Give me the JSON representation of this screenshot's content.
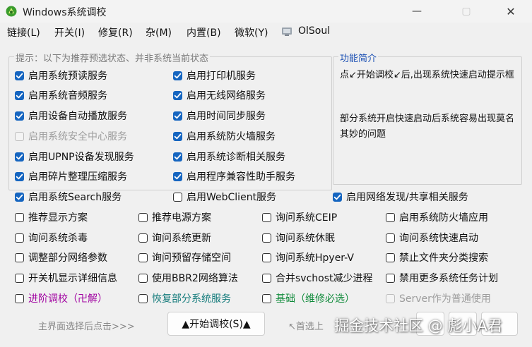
{
  "window": {
    "title": "Windows系统调校",
    "minimize": "—",
    "maximize": "▢",
    "close": "✕"
  },
  "menu": [
    "链接(L)",
    "开关(I)",
    "修复(R)",
    "杂(M)",
    "内置(B)",
    "微软(Y)",
    "OlSoul"
  ],
  "group": {
    "legend": "提示：以下为推荐预选状态、并非系统当前状态"
  },
  "info": {
    "title": "功能简介",
    "text1": "点↙开始调校↙后,出现系统快速启动提示框",
    "text2": "部分系统开启快速启动后系统容易出现莫名其妙的问题"
  },
  "checkboxes": [
    {
      "label": "启用系统预读服务",
      "checked": true
    },
    {
      "label": "启用打印机服务",
      "checked": true
    },
    {
      "label": "启用系统音频服务",
      "checked": true
    },
    {
      "label": "启用无线网络服务",
      "checked": true
    },
    {
      "label": "启用设备自动播放服务",
      "checked": true
    },
    {
      "label": "启用时间同步服务",
      "checked": true
    },
    {
      "label": "启用系统安全中心服务",
      "checked": false,
      "disabled": true
    },
    {
      "label": "启用系统防火墙服务",
      "checked": true
    },
    {
      "label": "启用UPNP设备发现服务",
      "checked": true
    },
    {
      "label": "启用系统诊断相关服务",
      "checked": true
    },
    {
      "label": "启用碎片整理压缩服务",
      "checked": true
    },
    {
      "label": "启用程序兼容性助手服务",
      "checked": true
    },
    {
      "label": "启用系统Search服务",
      "checked": true
    },
    {
      "label": "启用WebClient服务",
      "checked": false
    },
    {
      "label": "启用网络发现/共享相关服务",
      "checked": true
    },
    {
      "label": "推荐显示方案",
      "checked": false
    },
    {
      "label": "推荐电源方案",
      "checked": false
    },
    {
      "label": "询问系统CEIP",
      "checked": false
    },
    {
      "label": "启用系统防火墙应用",
      "checked": false
    },
    {
      "label": "询问系统杀毒",
      "checked": false
    },
    {
      "label": "询问系统更新",
      "checked": false
    },
    {
      "label": "询问系统休眠",
      "checked": false
    },
    {
      "label": "询问系统快速启动",
      "checked": false
    },
    {
      "label": "调整部分网络参数",
      "checked": false
    },
    {
      "label": "询问预留存储空间",
      "checked": false
    },
    {
      "label": "询问系统Hpyer-V",
      "checked": false
    },
    {
      "label": "禁止文件夹分类搜索",
      "checked": false
    },
    {
      "label": "开关机显示详细信息",
      "checked": false
    },
    {
      "label": "使用BBR2网络算法",
      "checked": false
    },
    {
      "label": "合并svchost减少进程",
      "checked": false
    },
    {
      "label": "禁用更多系统任务计划",
      "checked": false
    },
    {
      "label": "进阶调校（卍解）",
      "checked": false,
      "color": "#a000a0"
    },
    {
      "label": "恢复部分系统服务",
      "checked": false,
      "color": "#127a7a"
    },
    {
      "label": "基础（维修必选）",
      "checked": false,
      "color": "#0f8a3a"
    },
    {
      "label": "Server作为普通使用",
      "checked": false,
      "disabled": true
    }
  ],
  "footer": {
    "hint": "主界面选择后点击>>>",
    "start_button": "▲开始调校(S)▲",
    "after_hint": "↖首选上"
  },
  "watermark": "掘金技术社区 @ 彪小A君",
  "colors": {
    "checkbox_checked": "#1565c0",
    "info_title": "#1a4fb3",
    "hint": "#888888"
  }
}
